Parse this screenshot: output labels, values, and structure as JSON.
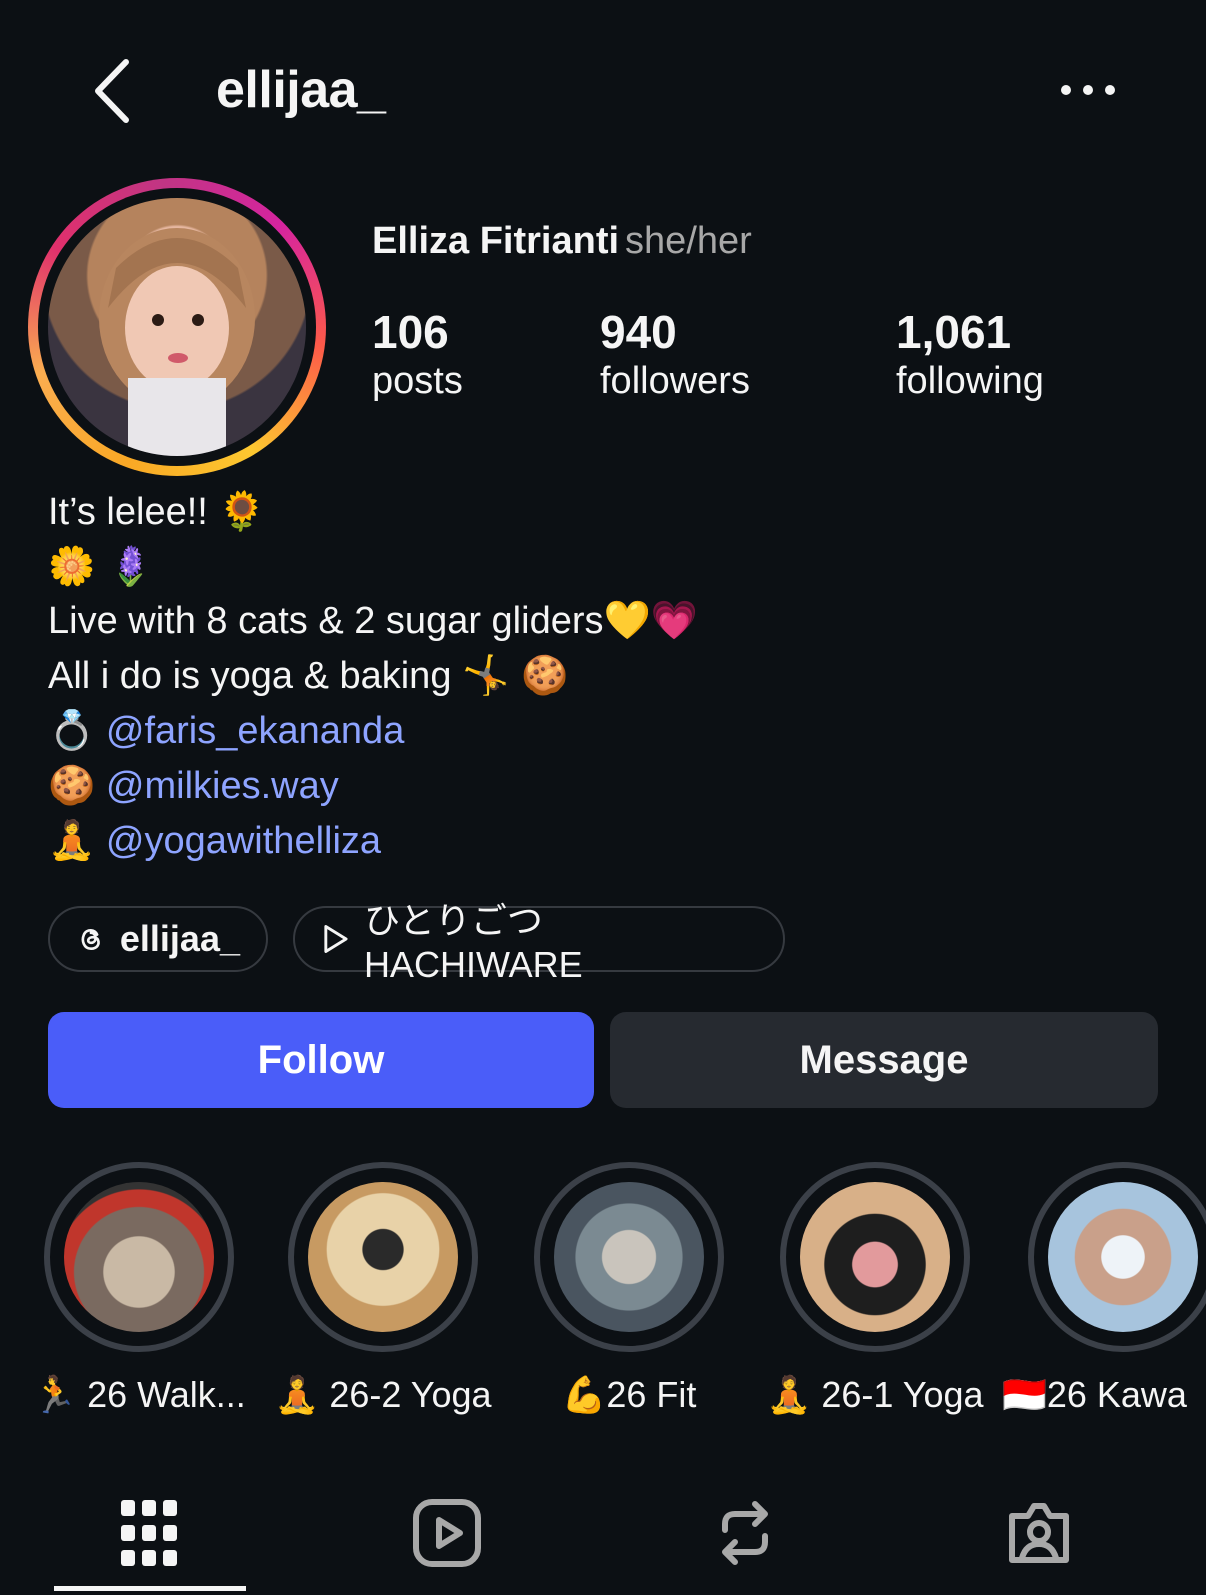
{
  "header": {
    "username": "ellijaa_",
    "back_icon": "chevron-left-icon",
    "more_icon": "more-horizontal-icon"
  },
  "profile": {
    "full_name": "Elliza Fitrianti",
    "pronouns": "she/her",
    "stats": {
      "posts": {
        "value": "106",
        "label": "posts"
      },
      "followers": {
        "value": "940",
        "label": "followers"
      },
      "following": {
        "value": "1,061",
        "label": "following"
      }
    }
  },
  "bio": {
    "line1_text": "It’s lelee!!",
    "line1_emoji": "🌻",
    "line2_emoji": "🌼 🪻",
    "line3_text": "Live with 8 cats & 2 sugar gliders",
    "line3_emoji": "💛💗",
    "line4_text": "All i do is yoga & baking",
    "line4_emoji": "🤸 🍪",
    "mentions": [
      {
        "emoji": "💍",
        "handle": "@faris_ekananda"
      },
      {
        "emoji": "🍪",
        "handle": "@milkies.way"
      },
      {
        "emoji": "🧘",
        "handle": "@yogawithelliza"
      }
    ]
  },
  "links": {
    "threads_handle": "ellijaa_",
    "threads_icon": "threads-icon",
    "music_title": "ひとりごつ HACHIWARE",
    "music_icon": "play-icon"
  },
  "actions": {
    "follow_label": "Follow",
    "message_label": "Message",
    "follow_color": "#4a5df9"
  },
  "highlights": [
    {
      "emoji": "🏃",
      "label": "26 Walk..."
    },
    {
      "emoji": "🧘",
      "label": "26-2 Yoga"
    },
    {
      "emoji": "💪",
      "label": "26 Fit"
    },
    {
      "emoji": "🧘",
      "label": "26-1 Yoga"
    },
    {
      "emoji": "🇮🇩",
      "label": "26 Kawa"
    }
  ],
  "tabs": [
    "grid-icon",
    "reels-icon",
    "reposts-icon",
    "tagged-icon"
  ]
}
